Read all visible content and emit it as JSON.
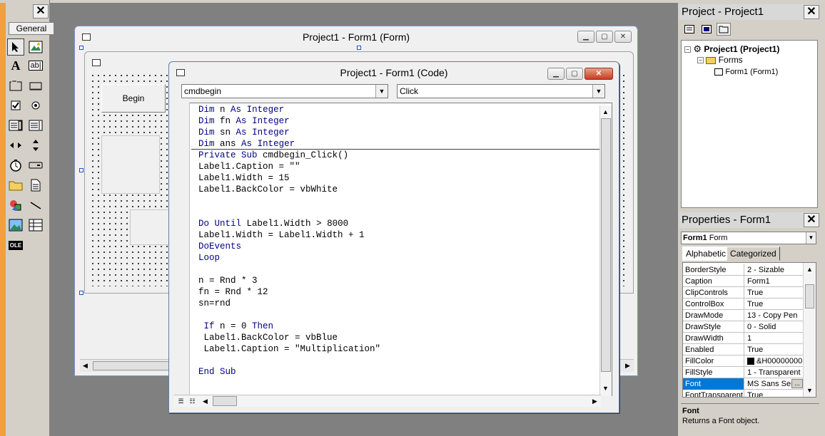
{
  "toolbox": {
    "general_label": "General",
    "close_glyph": "✕",
    "tools": [
      "pointer-icon",
      "picturebox-icon",
      "label-icon",
      "textbox-icon",
      "frame-icon",
      "commandbutton-icon",
      "checkbox-icon",
      "optionbutton-icon",
      "combobox-icon",
      "listbox-icon",
      "hscrollbar-icon",
      "vscrollbar-icon",
      "timer-icon",
      "drivelistbox-icon",
      "dirlistbox-icon",
      "filelistbox-icon",
      "shape-icon",
      "line-icon",
      "image-icon",
      "data-icon",
      "ole-icon"
    ],
    "label_glyph": "A",
    "textbox_glyph": "ab|",
    "ole_glyph": "OLE"
  },
  "form_window": {
    "title": "Project1 - Form1 (Form)",
    "begin_button": "Begin"
  },
  "code_window": {
    "title": "Project1 - Form1 (Code)",
    "object_combo": "cmdbegin",
    "proc_combo": "Click",
    "lines": [
      "Dim n As Integer",
      "Dim fn As Integer",
      "Dim sn As Integer",
      "Dim ans As Integer",
      "Private Sub cmdbegin_Click()",
      "Label1.Caption = \"\"",
      "Label1.Width = 15",
      "Label1.BackColor = vbWhite",
      "",
      "",
      "Do Until Label1.Width > 8000",
      "Label1.Width = Label1.Width + 1",
      "DoEvents",
      "Loop",
      "",
      "n = Rnd * 3",
      "fn = Rnd * 12",
      "sn=rnd",
      "",
      " If n = 0 Then",
      " Label1.BackColor = vbBlue",
      " Label1.Caption = \"Multiplication\"",
      "",
      "End Sub"
    ]
  },
  "project_panel": {
    "title": "Project - Project1",
    "root": "Project1 (Project1)",
    "folder": "Forms",
    "form": "Form1 (Form1)"
  },
  "properties_panel": {
    "title": "Properties - Form1",
    "object_name": "Form1",
    "object_type": "Form",
    "tab_alphabetic": "Alphabetic",
    "tab_categorized": "Categorized",
    "rows": [
      {
        "name": "BorderStyle",
        "value": "2 - Sizable"
      },
      {
        "name": "Caption",
        "value": "Form1"
      },
      {
        "name": "ClipControls",
        "value": "True"
      },
      {
        "name": "ControlBox",
        "value": "True"
      },
      {
        "name": "DrawMode",
        "value": "13 - Copy Pen"
      },
      {
        "name": "DrawStyle",
        "value": "0 - Solid"
      },
      {
        "name": "DrawWidth",
        "value": "1"
      },
      {
        "name": "Enabled",
        "value": "True"
      },
      {
        "name": "FillColor",
        "value": "&H00000000"
      },
      {
        "name": "FillStyle",
        "value": "1 - Transparent"
      },
      {
        "name": "Font",
        "value": "MS Sans Ser"
      },
      {
        "name": "FontTransparent",
        "value": "True"
      }
    ],
    "font_button": "...",
    "desc_title": "Font",
    "desc_text": "Returns a Font object."
  },
  "colors": {
    "mdi_background": "#808080",
    "selection": "#0078d7",
    "keyword": "#00008b"
  }
}
